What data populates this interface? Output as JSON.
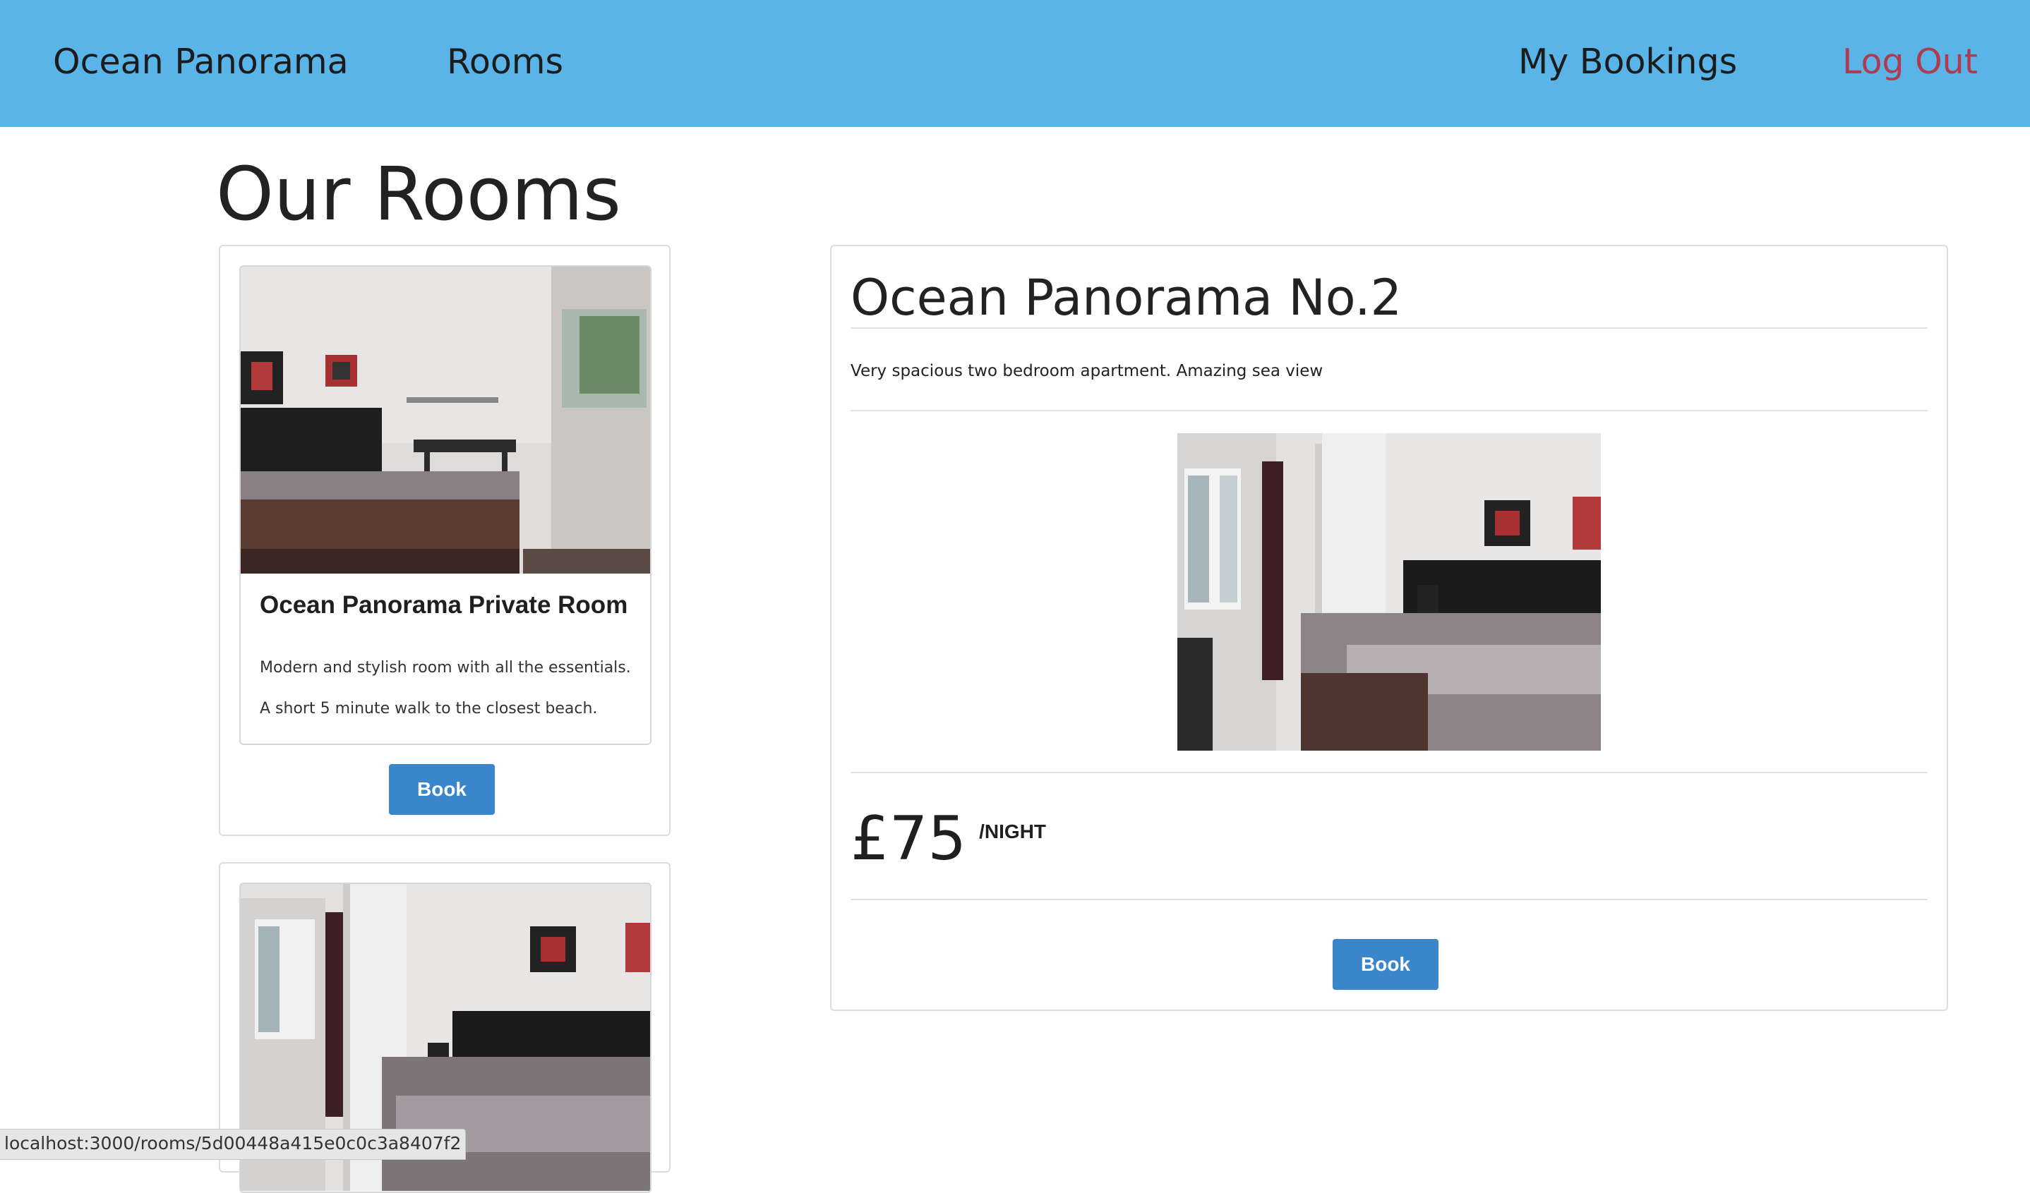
{
  "nav": {
    "brand": "Ocean Panorama",
    "rooms": "Rooms",
    "bookings": "My Bookings",
    "logout": "Log Out"
  },
  "page": {
    "title": "Our Rooms"
  },
  "rooms_list": [
    {
      "name": "Ocean Panorama Private Room",
      "description": "Modern and stylish room with all the essentials. A short 5 minute walk to the closest beach.",
      "book_label": "Book"
    },
    {
      "name": "",
      "description": "",
      "book_label": ""
    }
  ],
  "detail": {
    "title": "Ocean Panorama No.2",
    "description": "Very spacious two bedroom apartment. Amazing sea view",
    "price": "£75",
    "price_unit": "/NIGHT",
    "book_label": "Book"
  },
  "status_bar": {
    "url": "localhost:3000/rooms/5d00448a415e0c0c3a8407f2"
  },
  "colors": {
    "navbar": "#5ab4e7",
    "logout": "#b03a4e",
    "button": "#3b86cb"
  }
}
